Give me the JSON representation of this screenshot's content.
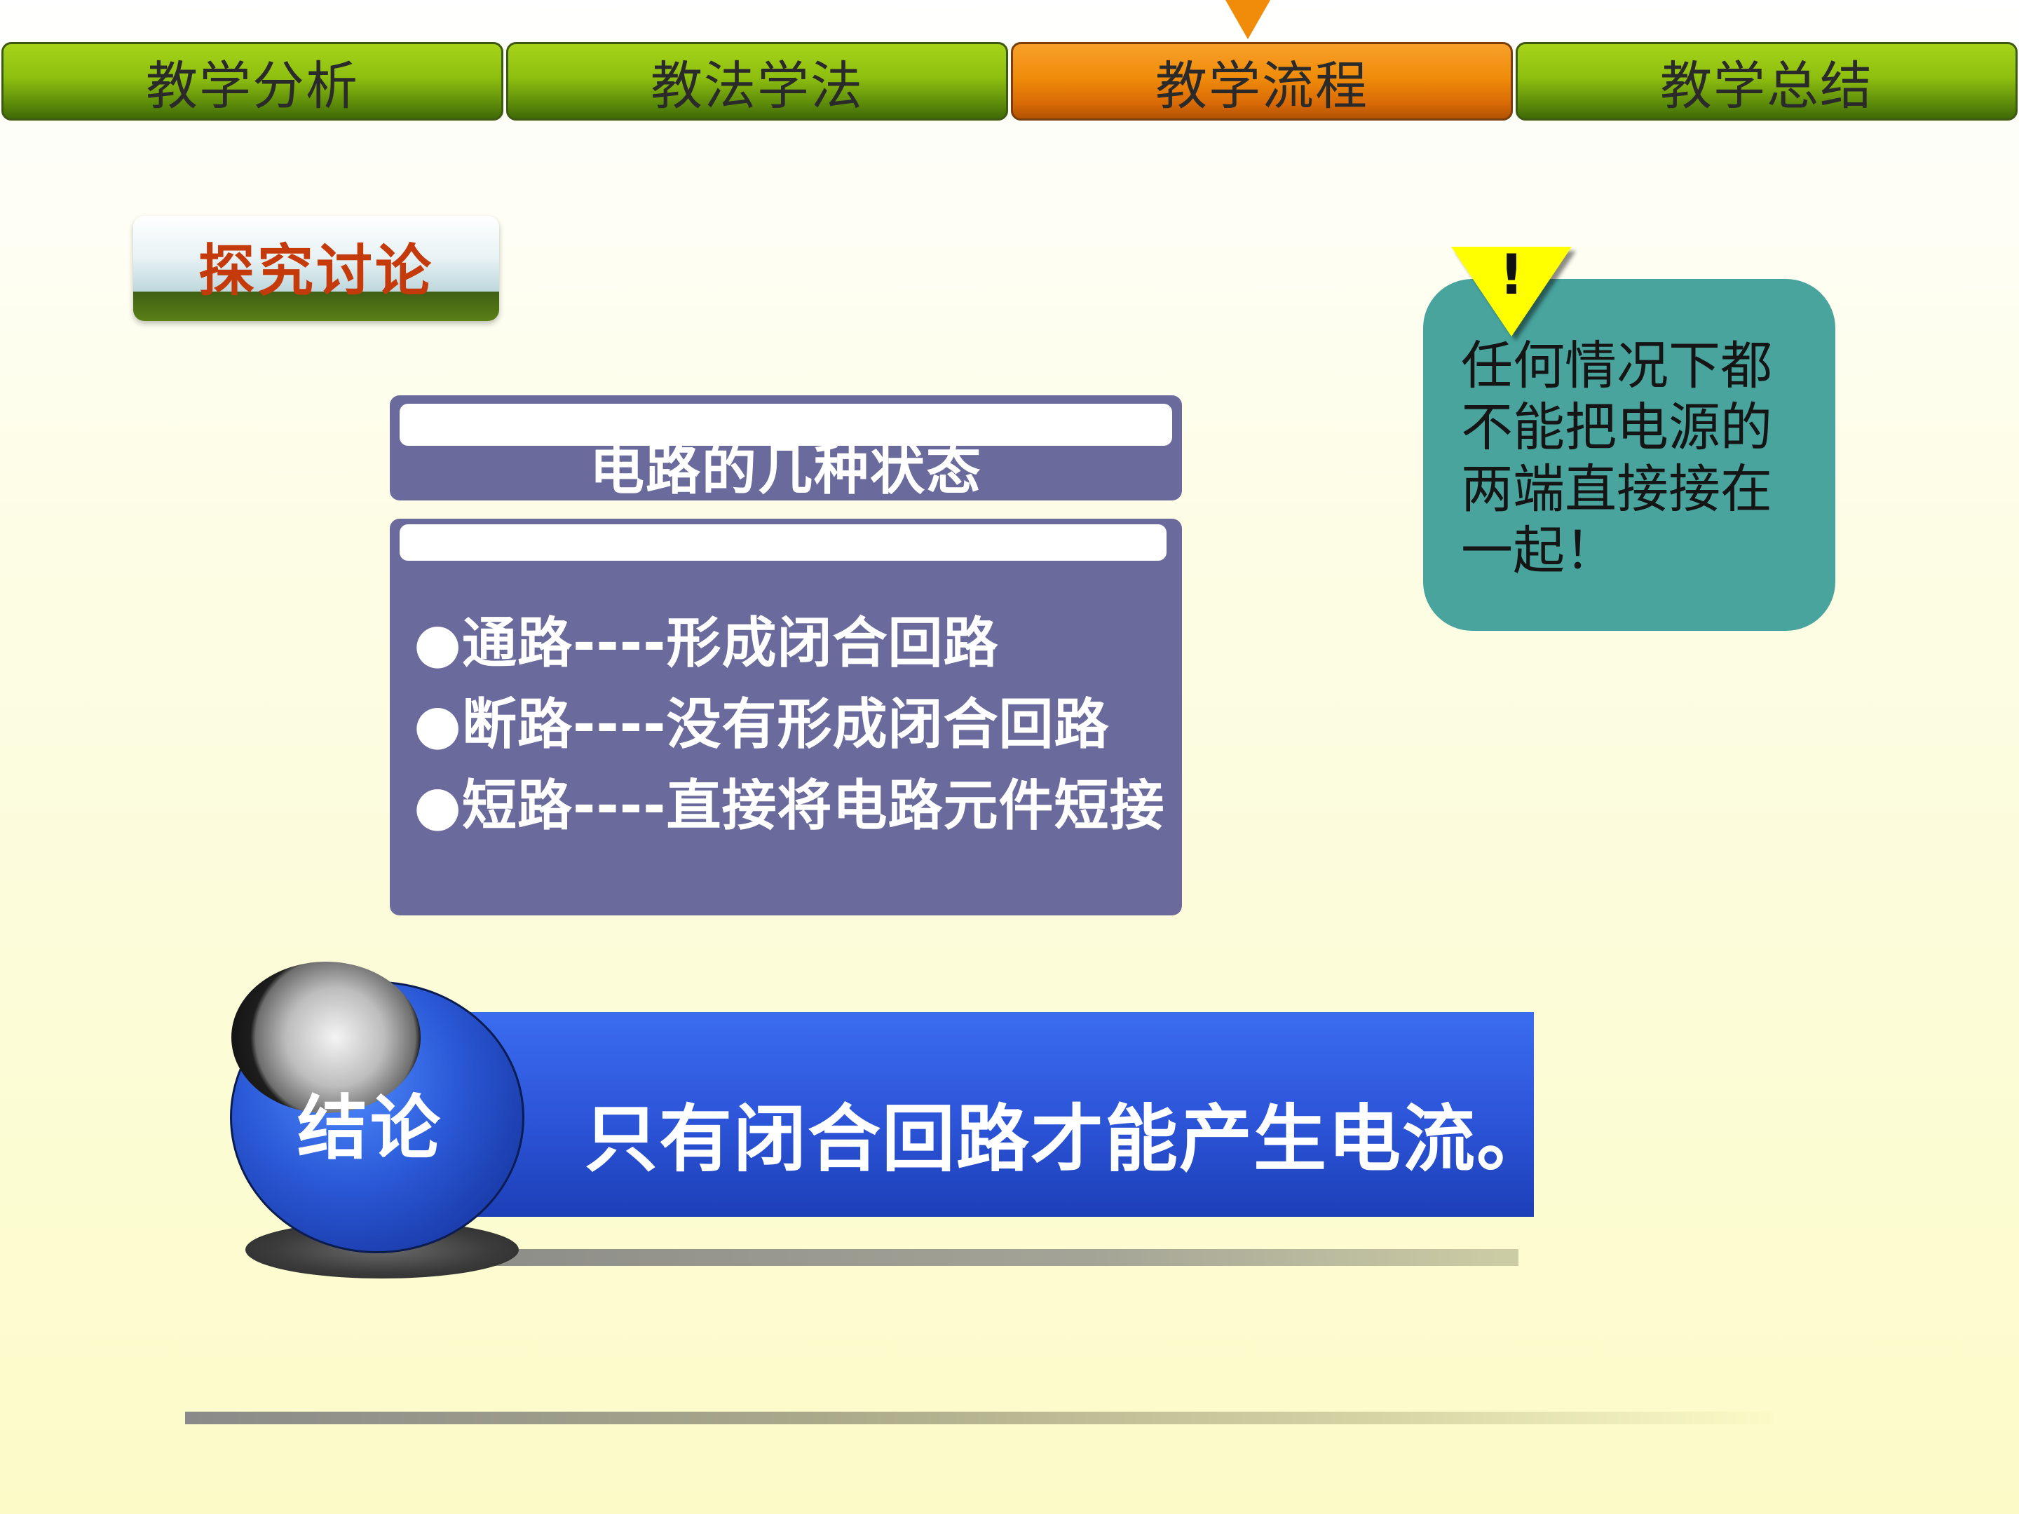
{
  "nav": {
    "tabs": [
      {
        "label": "教学分析"
      },
      {
        "label": "教法学法"
      },
      {
        "label": "教学流程"
      },
      {
        "label": "教学总结"
      }
    ]
  },
  "section": {
    "label": "探究讨论"
  },
  "states_panel": {
    "title": "电路的几种状态",
    "items": [
      "●通路----形成闭合回路",
      "●断路----没有形成闭合回路",
      "●短路----直接将电路元件短接"
    ]
  },
  "callout": {
    "mark": "!",
    "text": "任何情况下都不能把电源的两端直接接在一起！"
  },
  "conclusion": {
    "label": "结论",
    "text": "只有闭合回路才能产生电流。"
  },
  "colors": {
    "tab_green": "#8ebf0f",
    "tab_active_orange": "#f08c0a",
    "panel_purple": "#6a6a9c",
    "callout_teal": "#49a49e",
    "banner_blue": "#2d56da",
    "label_red": "#c53a0a"
  }
}
